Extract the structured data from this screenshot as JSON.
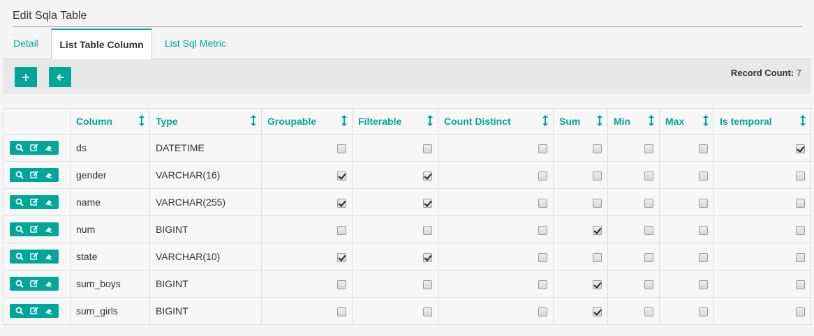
{
  "page": {
    "title": "Edit Sqla Table"
  },
  "tabs": [
    {
      "label": "Detail",
      "active": false
    },
    {
      "label": "List Table Column",
      "active": true
    },
    {
      "label": "List Sql Metric",
      "active": false
    }
  ],
  "toolbar": {
    "add_icon": "plus-icon",
    "back_icon": "arrow-left-icon",
    "record_count_label": "Record Count:",
    "record_count": "7"
  },
  "table": {
    "columns": [
      "Column",
      "Type",
      "Groupable",
      "Filterable",
      "Count Distinct",
      "Sum",
      "Min",
      "Max",
      "Is temporal"
    ],
    "row_actions": [
      "search-icon",
      "edit-icon",
      "eraser-icon"
    ],
    "rows": [
      {
        "column": "ds",
        "type": "DATETIME",
        "groupable": false,
        "filterable": false,
        "count_distinct": false,
        "sum": false,
        "min": false,
        "max": false,
        "is_temporal": true
      },
      {
        "column": "gender",
        "type": "VARCHAR(16)",
        "groupable": true,
        "filterable": true,
        "count_distinct": false,
        "sum": false,
        "min": false,
        "max": false,
        "is_temporal": false
      },
      {
        "column": "name",
        "type": "VARCHAR(255)",
        "groupable": true,
        "filterable": true,
        "count_distinct": false,
        "sum": false,
        "min": false,
        "max": false,
        "is_temporal": false
      },
      {
        "column": "num",
        "type": "BIGINT",
        "groupable": false,
        "filterable": false,
        "count_distinct": false,
        "sum": true,
        "min": false,
        "max": false,
        "is_temporal": false
      },
      {
        "column": "state",
        "type": "VARCHAR(10)",
        "groupable": true,
        "filterable": true,
        "count_distinct": false,
        "sum": false,
        "min": false,
        "max": false,
        "is_temporal": false
      },
      {
        "column": "sum_boys",
        "type": "BIGINT",
        "groupable": false,
        "filterable": false,
        "count_distinct": false,
        "sum": true,
        "min": false,
        "max": false,
        "is_temporal": false
      },
      {
        "column": "sum_girls",
        "type": "BIGINT",
        "groupable": false,
        "filterable": false,
        "count_distinct": false,
        "sum": true,
        "min": false,
        "max": false,
        "is_temporal": false
      }
    ]
  },
  "colors": {
    "accent": "#00a699",
    "text": "#333333",
    "background": "#f5f5f5"
  }
}
